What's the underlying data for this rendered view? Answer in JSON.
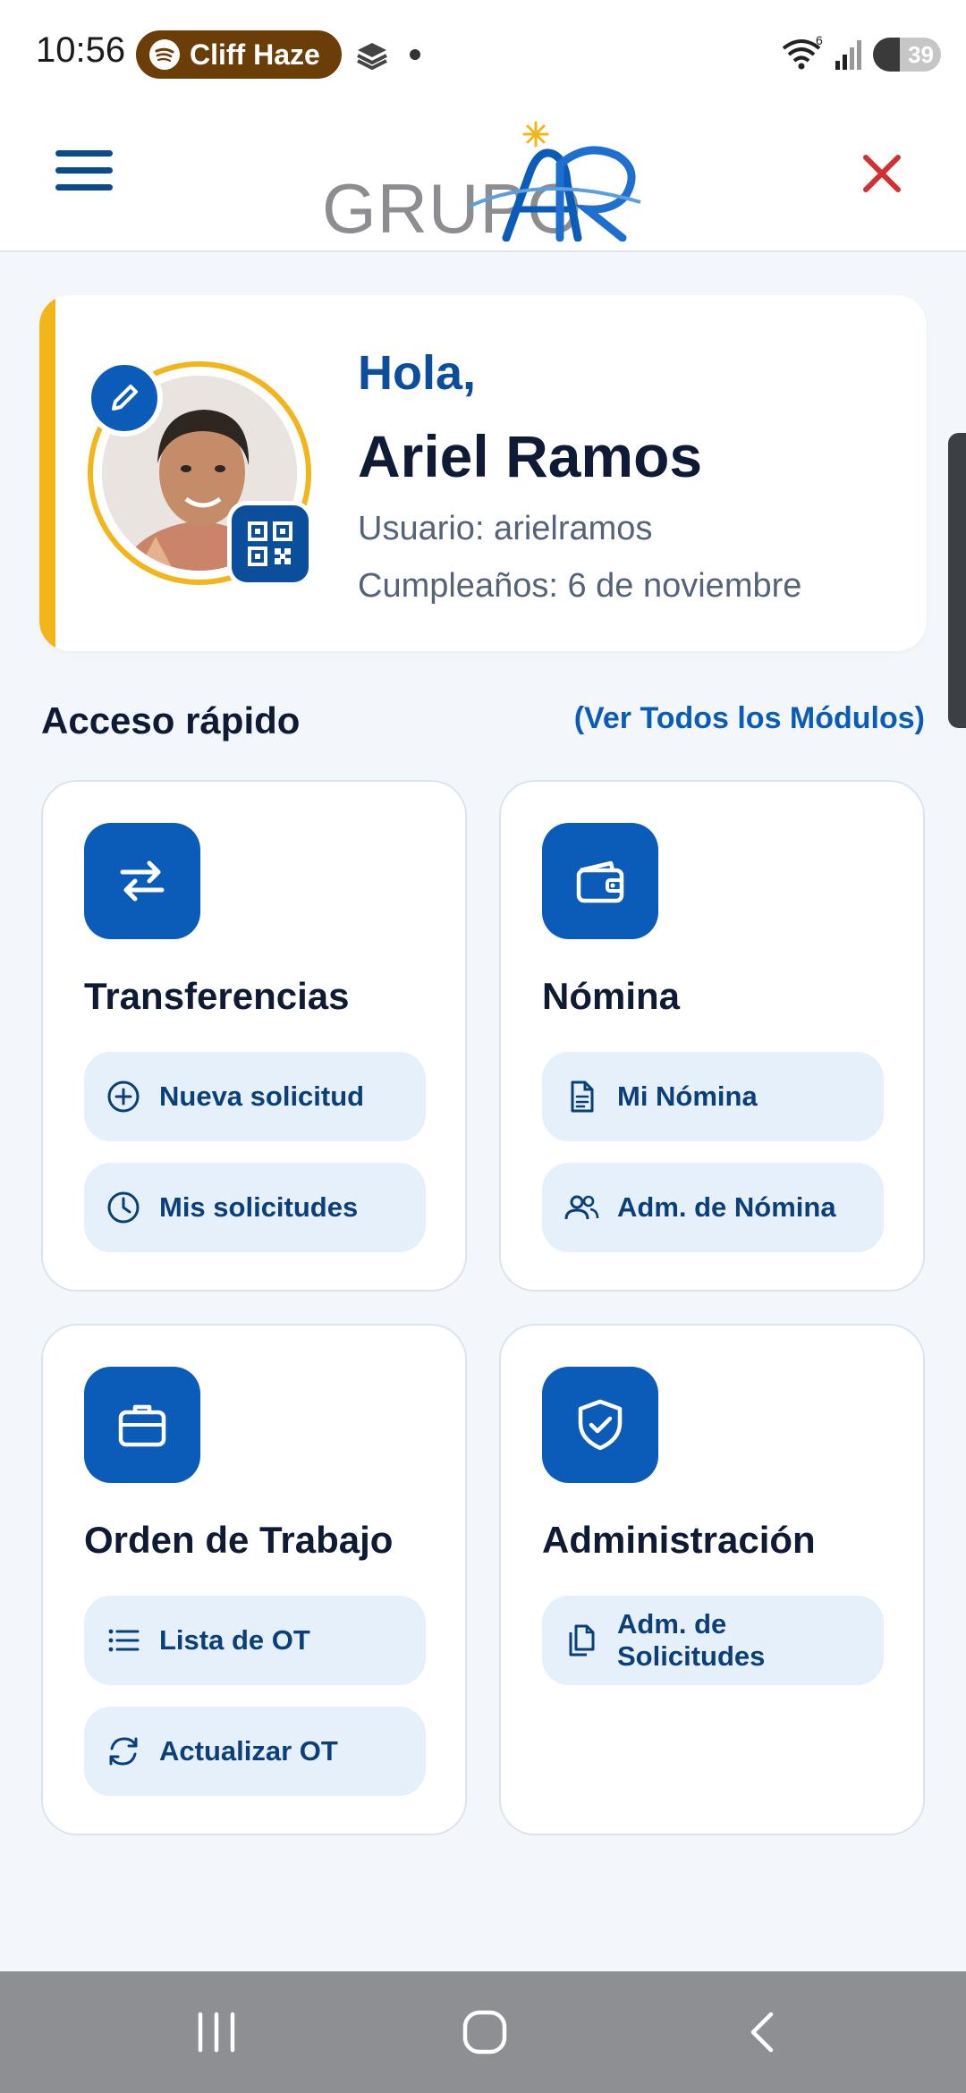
{
  "status_bar": {
    "time": "10:56",
    "media_pill": "Cliff Haze",
    "network": "6",
    "battery": "39",
    "battery_level_percent": 39
  },
  "header": {
    "logo_text": "GRUPO",
    "logo_mark": "AR",
    "colors": {
      "brand_blue": "#0b5cb8",
      "accent_yellow": "#f2b51a",
      "close_red": "#d32f2f"
    }
  },
  "profile": {
    "greeting": "Hola,",
    "name": "Ariel Ramos",
    "username": "Usuario: arielramos",
    "birthday": "Cumpleaños: 6 de noviembre"
  },
  "quick_access": {
    "title": "Acceso rápido",
    "see_all": "(Ver Todos los Módulos)"
  },
  "modules": [
    {
      "title": "Transferencias",
      "icon": "transfer-arrows-icon",
      "actions": [
        {
          "label": "Nueva solicitud",
          "icon": "plus-circle-icon"
        },
        {
          "label": "Mis solicitudes",
          "icon": "clock-icon"
        }
      ]
    },
    {
      "title": "Nómina",
      "icon": "wallet-icon",
      "actions": [
        {
          "label": "Mi Nómina",
          "icon": "document-icon"
        },
        {
          "label": "Adm. de Nómina",
          "icon": "users-icon"
        }
      ]
    },
    {
      "title": "Orden de Trabajo",
      "icon": "briefcase-icon",
      "actions": [
        {
          "label": "Lista de OT",
          "icon": "list-icon"
        },
        {
          "label": "Actualizar OT",
          "icon": "refresh-icon"
        }
      ]
    },
    {
      "title": "Administración",
      "icon": "shield-check-icon",
      "actions": [
        {
          "label": "Adm. de Solicitudes",
          "icon": "files-icon"
        }
      ]
    }
  ]
}
